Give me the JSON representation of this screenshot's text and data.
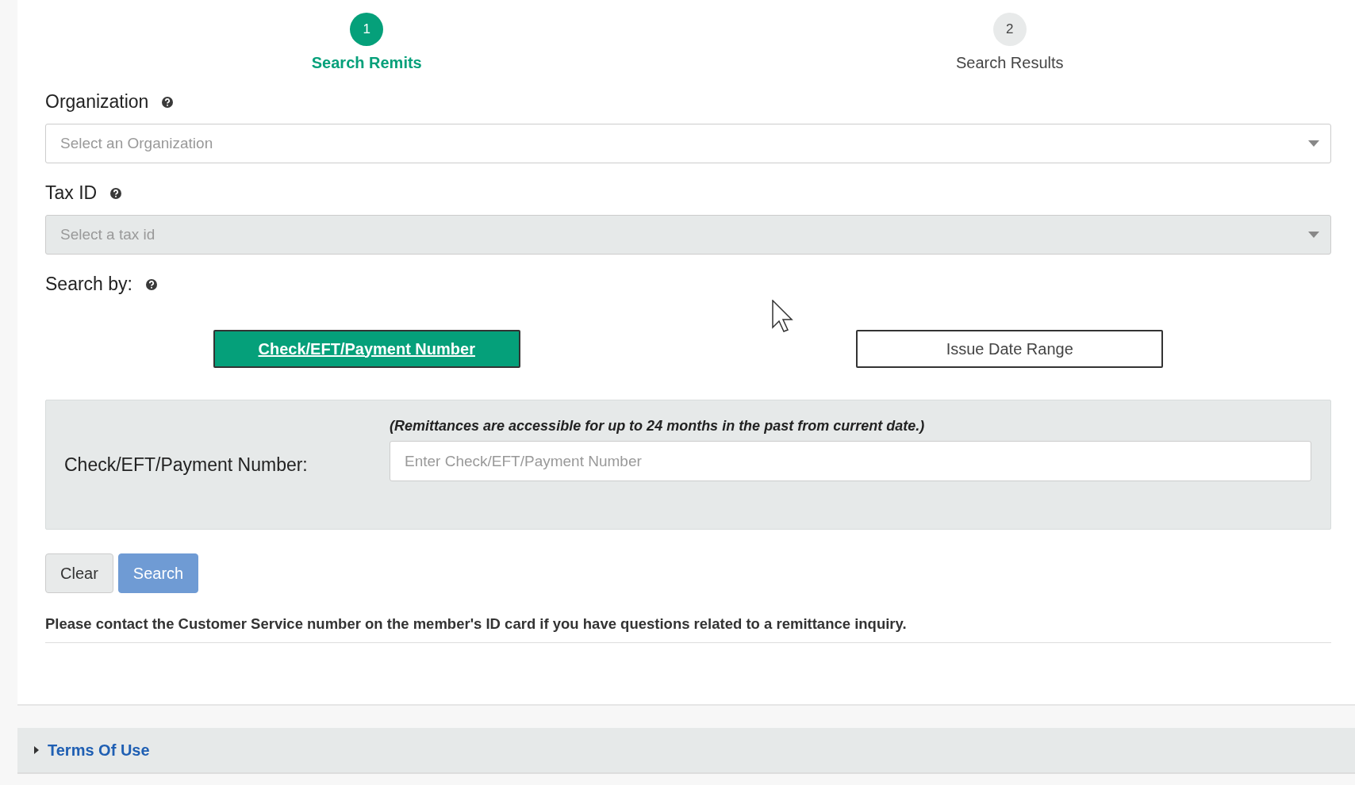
{
  "steps": [
    {
      "number": "1",
      "label": "Search Remits",
      "selected": true
    },
    {
      "number": "2",
      "label": "Search Results",
      "selected": false
    }
  ],
  "fields": [
    {
      "label": "Organization",
      "placeholder": "Select an Organization",
      "disabled": false
    },
    {
      "label": "Tax ID",
      "placeholder": "Select a tax id",
      "disabled": true
    }
  ],
  "search_by": {
    "label": "Search by:",
    "options": [
      {
        "label": "Check/EFT/Payment Number",
        "selected": true
      },
      {
        "label": "Issue Date Range",
        "selected": false
      }
    ]
  },
  "criteria": {
    "note": "(Remittances are accessible for up to 24 months in the past from current date.)",
    "label": "Check/EFT/Payment Number:",
    "placeholder": "Enter Check/EFT/Payment Number"
  },
  "buttons": [
    {
      "label": "Clear",
      "kind": "secondary"
    },
    {
      "label": "Search",
      "kind": "primary"
    }
  ],
  "notice": "Please contact the Customer Service number on the member's ID card if you have questions related to a remittance inquiry.",
  "footer": {
    "label": "Terms Of Use",
    "expanded": false
  }
}
